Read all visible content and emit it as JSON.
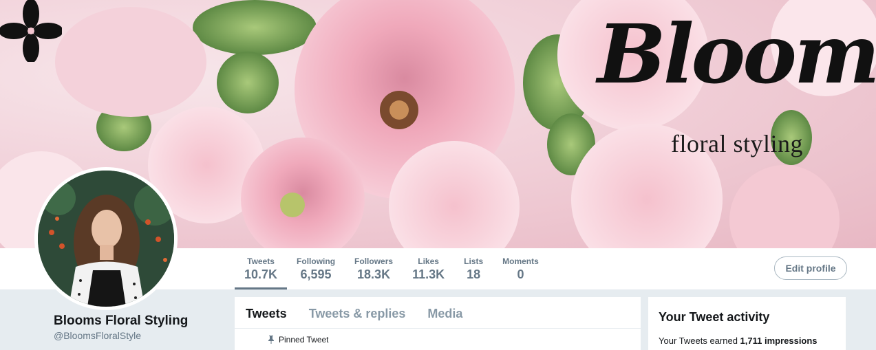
{
  "banner": {
    "brand_script": "Blooms",
    "brand_sub": "floral styling"
  },
  "nav": {
    "stats": [
      {
        "label": "Tweets",
        "value": "10.7K"
      },
      {
        "label": "Following",
        "value": "6,595"
      },
      {
        "label": "Followers",
        "value": "18.3K"
      },
      {
        "label": "Likes",
        "value": "11.3K"
      },
      {
        "label": "Lists",
        "value": "18"
      },
      {
        "label": "Moments",
        "value": "0"
      }
    ],
    "edit_profile": "Edit profile"
  },
  "profile": {
    "name": "Blooms Floral Styling",
    "handle": "@BloomsFloralStyle"
  },
  "timeline": {
    "tabs": [
      "Tweets",
      "Tweets & replies",
      "Media"
    ],
    "pinned_label": "Pinned Tweet"
  },
  "activity": {
    "title": "Your Tweet activity",
    "text_prefix": "Your Tweets earned ",
    "impressions": "1,711 impressions"
  },
  "colors": {
    "accent_gray": "#657786",
    "background": "#e6ecf0",
    "banner_pink": "#f2c4cf"
  }
}
